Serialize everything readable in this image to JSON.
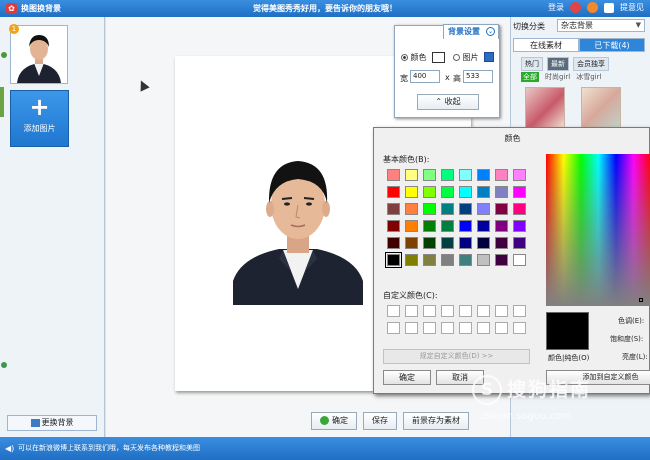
{
  "title_bar": {
    "app_title": "换图换背景",
    "center_message": "觉得美图秀秀好用，要告诉你的朋友哦！",
    "login_label": "登录",
    "help_label": "提意见"
  },
  "left_panel": {
    "add_photo_label": "添加图片",
    "change_bg_label": "更换背景",
    "thumb_badge": "1"
  },
  "bg_settings": {
    "tab_label": "背景设置",
    "color_option_label": "颜色",
    "picture_option_label": "图片",
    "width_label": "宽",
    "width_value": "400",
    "times_sign": "x",
    "height_label": "高",
    "height_value": "533",
    "collapse_label": "收起",
    "selected_option": "颜色"
  },
  "right_panel": {
    "category_label": "切换分类",
    "category_value": "杂志背景",
    "tabs": [
      {
        "label": "在线素材"
      },
      {
        "label": "已下载(4)"
      }
    ],
    "subtabs": [
      {
        "label": "热门"
      },
      {
        "label": "最新"
      },
      {
        "label": "会员独享"
      }
    ],
    "filters": [
      {
        "label": "全部"
      },
      {
        "label": "时尚girl"
      },
      {
        "label": "冰雪girl"
      }
    ]
  },
  "color_dialog": {
    "title": "颜色",
    "basic_colors_label": "基本颜色(B):",
    "custom_colors_label": "自定义颜色(C):",
    "define_custom_label": "规定自定义颜色(D) >>",
    "ok_label": "确定",
    "cancel_label": "取消",
    "color_solid_label": "颜色|纯色(O)",
    "hue_label": "色调(E):",
    "sat_label": "饱和度(S):",
    "lum_label": "亮度(L):",
    "add_custom_label": "添加到自定义颜色",
    "basic_colors": [
      "#ff8080",
      "#ffff80",
      "#80ff80",
      "#00ff80",
      "#80ffff",
      "#0080ff",
      "#ff80c0",
      "#ff80ff",
      "#ff0000",
      "#ffff00",
      "#80ff00",
      "#00ff40",
      "#00ffff",
      "#0080c0",
      "#8080c0",
      "#ff00ff",
      "#804040",
      "#ff8040",
      "#00ff00",
      "#008080",
      "#004080",
      "#8080ff",
      "#800040",
      "#ff0080",
      "#800000",
      "#ff8000",
      "#008000",
      "#008040",
      "#0000ff",
      "#0000a0",
      "#800080",
      "#8000ff",
      "#400000",
      "#804000",
      "#004000",
      "#004040",
      "#000080",
      "#000040",
      "#400040",
      "#400080",
      "#000000",
      "#808000",
      "#808040",
      "#808080",
      "#408080",
      "#c0c0c0",
      "#400040",
      "#ffffff"
    ],
    "selected_color": "#000000"
  },
  "canvas_buttons": {
    "ok_label": "确定",
    "save_label": "保存",
    "save_material_label": "前景存为素材"
  },
  "status_bar": {
    "text": "可以在新浪微博上联系到我们哦，每天发布各种教程和美图"
  },
  "watermark": {
    "logo_char": "S",
    "brand_text": "搜狗指南",
    "url_text": "zhinan.sogou.com"
  },
  "colors": {
    "title_bar": "#1f6fc4",
    "accent": "#2f86d9"
  }
}
